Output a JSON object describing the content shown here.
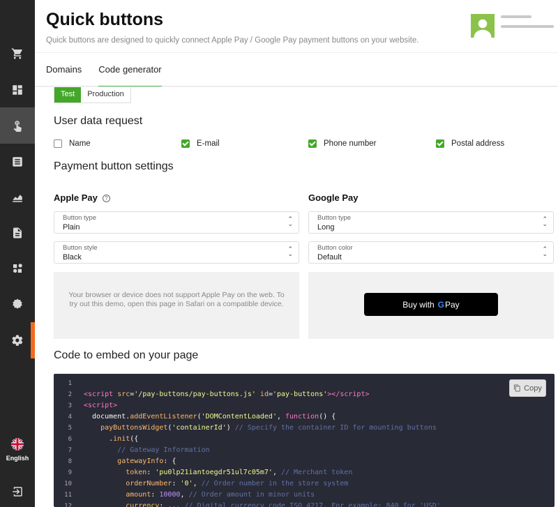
{
  "header": {
    "title": "Quick buttons",
    "subtitle": "Quick buttons are designed to quickly connect Apple Pay / Google Pay payment buttons on your website.",
    "tabs": [
      {
        "label": "Domains"
      },
      {
        "label": "Code generator"
      }
    ]
  },
  "sidebar": {
    "icons": [
      "cart-icon",
      "dashboard-icon",
      "quick-buttons-icon",
      "list-icon",
      "chart-icon",
      "reports-icon",
      "integrations-icon",
      "certificate-icon",
      "settings-icon"
    ],
    "language": "English"
  },
  "mode": {
    "test": "Test",
    "production": "Production"
  },
  "user_data": {
    "title": "User data request",
    "fields": [
      {
        "label": "Name",
        "checked": false
      },
      {
        "label": "E-mail",
        "checked": true
      },
      {
        "label": "Phone number",
        "checked": true
      },
      {
        "label": "Postal address",
        "checked": true
      }
    ]
  },
  "settings": {
    "title": "Payment button settings",
    "apple": {
      "title": "Apple Pay",
      "type_label": "Button type",
      "type_value": "Plain",
      "style_label": "Button style",
      "style_value": "Black",
      "unsupported_msg": "Your browser or device does not support Apple Pay on the web. To try out this demo, open this page in Safari on a compatible device."
    },
    "google": {
      "title": "Google Pay",
      "type_label": "Button type",
      "type_value": "Long",
      "color_label": "Button color",
      "color_value": "Default",
      "button_text": "Buy with",
      "button_g": "G",
      "button_pay": "Pay"
    }
  },
  "embed": {
    "title": "Code to embed on your page",
    "copy_label": "Copy",
    "line_numbers": [
      "1",
      "2",
      "3",
      "4",
      "5",
      "6",
      "7",
      "8",
      "9",
      "10",
      "11",
      "12"
    ]
  },
  "colors": {
    "accent_green": "#43a829",
    "sidebar_bg": "#262626",
    "sidebar_accent": "#f26b1d",
    "code_bg": "#282a36"
  }
}
